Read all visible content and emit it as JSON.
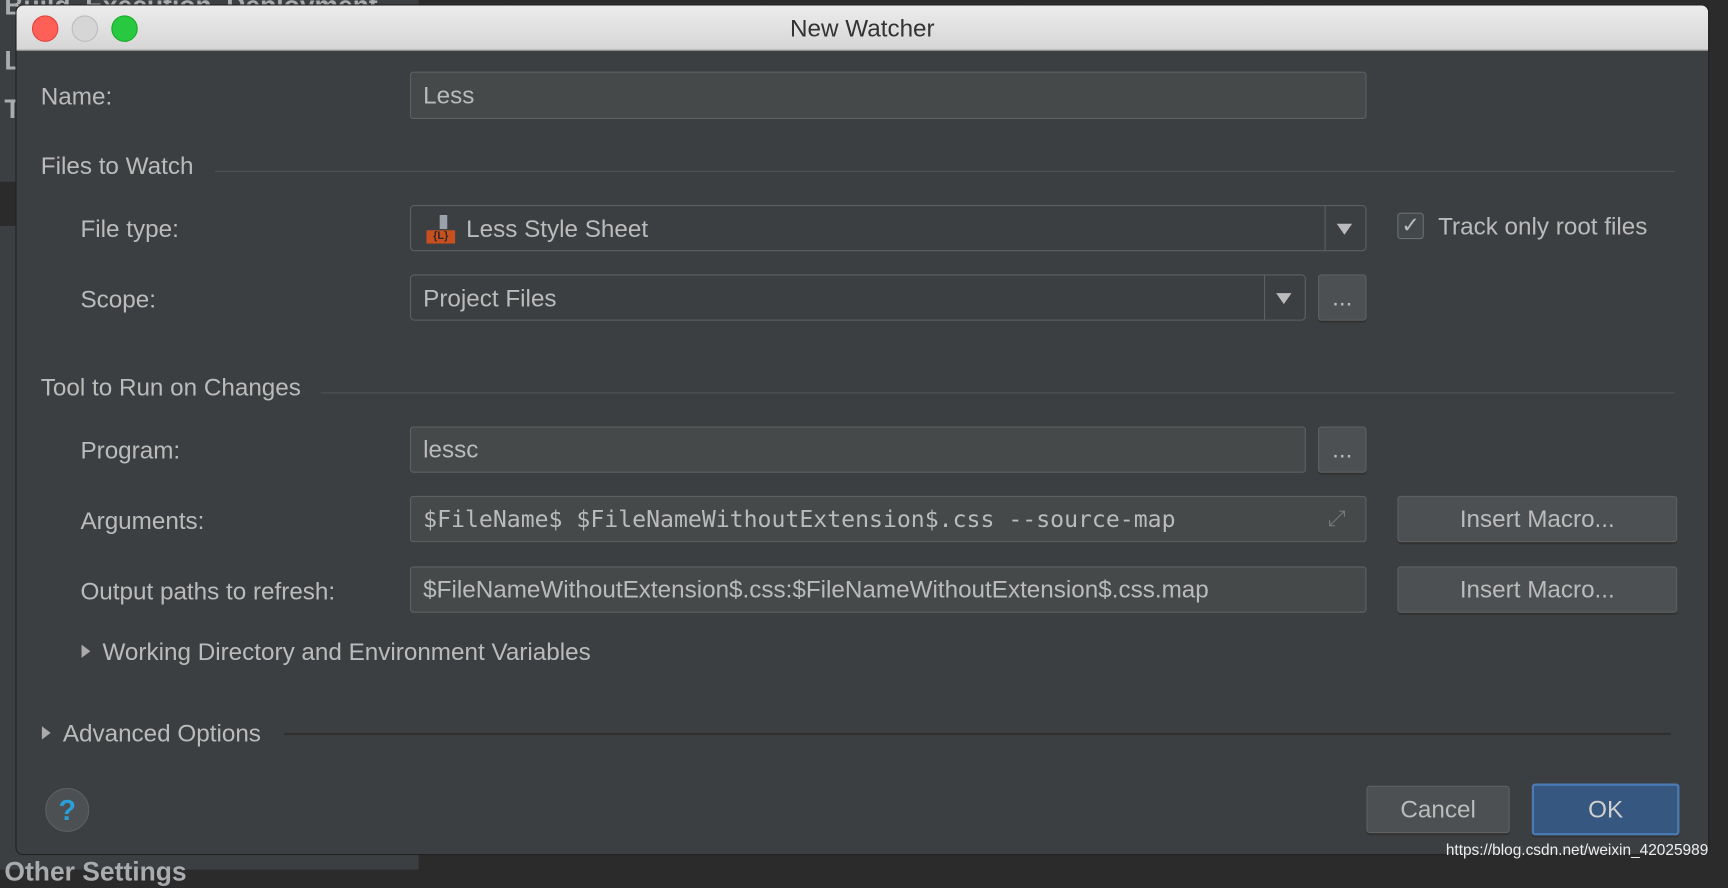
{
  "background": {
    "settings_items": [
      "Build, Execution, Deployment",
      "L",
      "T",
      "Other Settings"
    ]
  },
  "dialog": {
    "title": "New Watcher",
    "name_label": "Name:",
    "name_value": "Less",
    "files_section": "Files to Watch",
    "file_type_label": "File type:",
    "file_type_value": "Less Style Sheet",
    "file_type_icon": "{L}",
    "track_root_label": "Track only root files",
    "track_root_checked": true,
    "scope_label": "Scope:",
    "scope_value": "Project Files",
    "browse_label": "...",
    "tool_section": "Tool to Run on Changes",
    "program_label": "Program:",
    "program_value": "lessc",
    "arguments_label": "Arguments:",
    "arguments_value": "$FileName$ $FileNameWithoutExtension$.css --source-map",
    "output_label": "Output paths to refresh:",
    "output_value": "$FileNameWithoutExtension$.css:$FileNameWithoutExtension$.css.map",
    "insert_macro_label": "Insert Macro...",
    "working_dir_label": "Working Directory and Environment Variables",
    "advanced_label": "Advanced Options",
    "help_label": "?",
    "cancel_label": "Cancel",
    "ok_label": "OK"
  },
  "colors": {
    "ok_button": "#365880",
    "file_icon": "#c8501e",
    "help": "#2a9fd8"
  },
  "watermark": "https://blog.csdn.net/weixin_42025989"
}
